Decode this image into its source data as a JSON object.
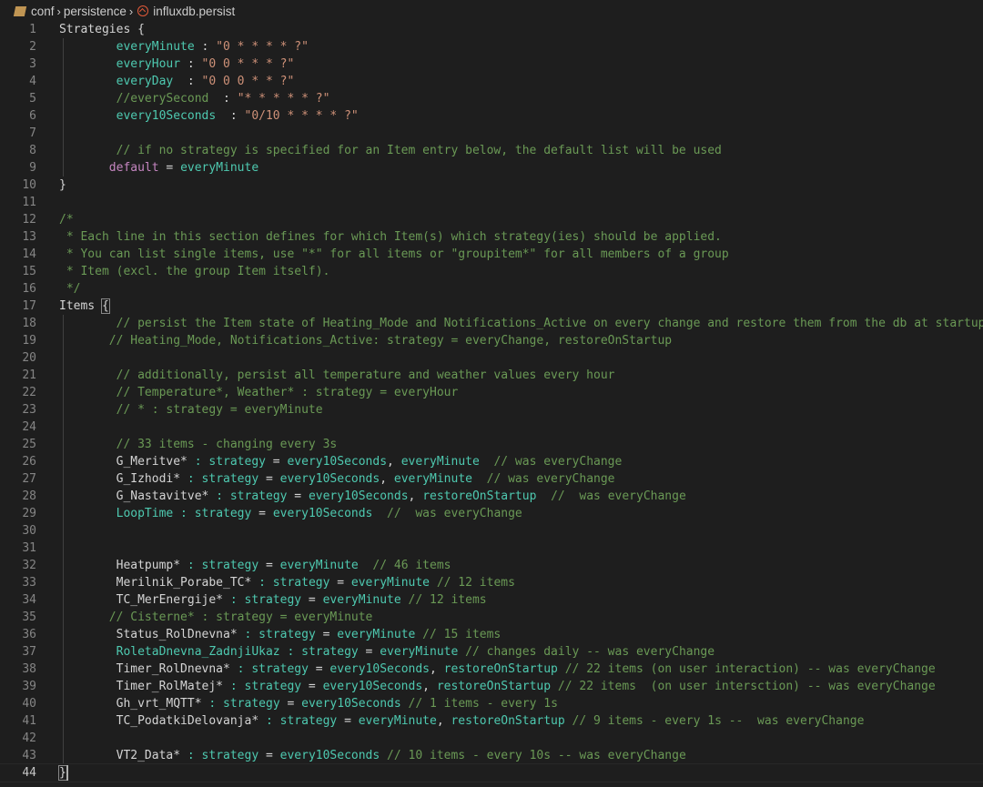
{
  "breadcrumb": {
    "items": [
      "conf",
      "persistence",
      "influxdb.persist"
    ]
  },
  "colors": {
    "background": "#1e1e1e",
    "type": "#4ec9b0",
    "string": "#ce9178",
    "comment": "#6a9955",
    "keyword": "#c586c0",
    "text": "#d4d4d4"
  },
  "editor": {
    "current_line": 44,
    "lines": [
      [
        [
          "Strategies {",
          "k"
        ]
      ],
      [
        [
          "        everyMinute",
          "t"
        ],
        [
          " : ",
          "k"
        ],
        [
          "\"0 * * * * ?\"",
          "s"
        ]
      ],
      [
        [
          "        everyHour",
          "t"
        ],
        [
          " : ",
          "k"
        ],
        [
          "\"0 0 * * * ?\"",
          "s"
        ]
      ],
      [
        [
          "        everyDay",
          "t"
        ],
        [
          "  : ",
          "k"
        ],
        [
          "\"0 0 0 * * ?\"",
          "s"
        ]
      ],
      [
        [
          "        //everySecond",
          "c"
        ],
        [
          "  : ",
          "k"
        ],
        [
          "\"* * * * * ?\"",
          "s"
        ]
      ],
      [
        [
          "        every10Seconds",
          "t"
        ],
        [
          "  : ",
          "k"
        ],
        [
          "\"0/10 * * * * ?\"",
          "s"
        ]
      ],
      [],
      [
        [
          "        // if no strategy is specified for an Item entry below, the default list will be used",
          "c"
        ]
      ],
      [
        [
          "       default",
          "p"
        ],
        [
          " = ",
          "k"
        ],
        [
          "everyMinute",
          "t"
        ]
      ],
      [
        [
          "}",
          "k"
        ]
      ],
      [],
      [
        [
          "/*",
          "c"
        ]
      ],
      [
        [
          " * Each line in this section defines for which Item(s) which strategy(ies) should be applied.",
          "c"
        ]
      ],
      [
        [
          " * You can list single items, use \"*\" for all items or \"groupitem*\" for all members of a group",
          "c"
        ]
      ],
      [
        [
          " * Item (excl. the group Item itself).",
          "c"
        ]
      ],
      [
        [
          " */",
          "c"
        ]
      ],
      [
        [
          "Items ",
          "k"
        ],
        [
          "{",
          "b"
        ]
      ],
      [
        [
          "        // persist the Item state of Heating_Mode and Notifications_Active on every change and restore them from the db at startup",
          "c"
        ]
      ],
      [
        [
          "       // Heating_Mode, Notifications_Active: strategy = everyChange, restoreOnStartup",
          "c"
        ]
      ],
      [],
      [
        [
          "        // additionally, persist all temperature and weather values every hour",
          "c"
        ]
      ],
      [
        [
          "        // Temperature*, Weather* : strategy = everyHour",
          "c"
        ]
      ],
      [
        [
          "        // * : strategy = everyMinute",
          "c"
        ]
      ],
      [],
      [
        [
          "        // 33 items - changing every 3s",
          "c"
        ]
      ],
      [
        [
          "        G_Meritve*",
          "k"
        ],
        [
          " : strategy",
          "t"
        ],
        [
          " = ",
          "k"
        ],
        [
          "every10Seconds",
          "t"
        ],
        [
          ", ",
          "k"
        ],
        [
          "everyMinute",
          "t"
        ],
        [
          "  // was everyChange",
          "c"
        ]
      ],
      [
        [
          "        G_Izhodi*",
          "k"
        ],
        [
          " : strategy",
          "t"
        ],
        [
          " = ",
          "k"
        ],
        [
          "every10Seconds",
          "t"
        ],
        [
          ", ",
          "k"
        ],
        [
          "everyMinute",
          "t"
        ],
        [
          "  // was everyChange",
          "c"
        ]
      ],
      [
        [
          "        G_Nastavitve*",
          "k"
        ],
        [
          " : strategy",
          "t"
        ],
        [
          " = ",
          "k"
        ],
        [
          "every10Seconds",
          "t"
        ],
        [
          ", ",
          "k"
        ],
        [
          "restoreOnStartup",
          "t"
        ],
        [
          "  //  was everyChange",
          "c"
        ]
      ],
      [
        [
          "        LoopTime",
          "t"
        ],
        [
          " : strategy",
          "t"
        ],
        [
          " = ",
          "k"
        ],
        [
          "every10Seconds",
          "t"
        ],
        [
          "  //  was everyChange",
          "c"
        ]
      ],
      [],
      [],
      [
        [
          "        Heatpump*",
          "k"
        ],
        [
          " : strategy",
          "t"
        ],
        [
          " = ",
          "k"
        ],
        [
          "everyMinute",
          "t"
        ],
        [
          "  // 46 items",
          "c"
        ]
      ],
      [
        [
          "        Merilnik_Porabe_TC*",
          "k"
        ],
        [
          " : strategy",
          "t"
        ],
        [
          " = ",
          "k"
        ],
        [
          "everyMinute",
          "t"
        ],
        [
          " // 12 items",
          "c"
        ]
      ],
      [
        [
          "        TC_MerEnergije*",
          "k"
        ],
        [
          " : strategy",
          "t"
        ],
        [
          " = ",
          "k"
        ],
        [
          "everyMinute",
          "t"
        ],
        [
          " // 12 items",
          "c"
        ]
      ],
      [
        [
          "       // Cisterne* : strategy = everyMinute",
          "c"
        ]
      ],
      [
        [
          "        Status_RolDnevna*",
          "k"
        ],
        [
          " : strategy",
          "t"
        ],
        [
          " = ",
          "k"
        ],
        [
          "everyMinute",
          "t"
        ],
        [
          " // 15 items",
          "c"
        ]
      ],
      [
        [
          "        RoletaDnevna_ZadnjiUkaz",
          "t"
        ],
        [
          " : strategy",
          "t"
        ],
        [
          " = ",
          "k"
        ],
        [
          "everyMinute",
          "t"
        ],
        [
          " // changes daily -- was everyChange",
          "c"
        ]
      ],
      [
        [
          "        Timer_RolDnevna*",
          "k"
        ],
        [
          " : strategy",
          "t"
        ],
        [
          " = ",
          "k"
        ],
        [
          "every10Seconds",
          "t"
        ],
        [
          ", ",
          "k"
        ],
        [
          "restoreOnStartup",
          "t"
        ],
        [
          " // 22 items (on user interaction) -- was everyChange",
          "c"
        ]
      ],
      [
        [
          "        Timer_RolMatej*",
          "k"
        ],
        [
          " : strategy",
          "t"
        ],
        [
          " = ",
          "k"
        ],
        [
          "every10Seconds",
          "t"
        ],
        [
          ", ",
          "k"
        ],
        [
          "restoreOnStartup",
          "t"
        ],
        [
          " // 22 items  (on user intersction) -- was everyChange",
          "c"
        ]
      ],
      [
        [
          "        Gh_vrt_MQTT*",
          "k"
        ],
        [
          " : strategy",
          "t"
        ],
        [
          " = ",
          "k"
        ],
        [
          "every10Seconds",
          "t"
        ],
        [
          " // 1 items - every 1s",
          "c"
        ]
      ],
      [
        [
          "        TC_PodatkiDelovanja*",
          "k"
        ],
        [
          " : strategy",
          "t"
        ],
        [
          " = ",
          "k"
        ],
        [
          "everyMinute",
          "t"
        ],
        [
          ", ",
          "k"
        ],
        [
          "restoreOnStartup",
          "t"
        ],
        [
          " // 9 items - every 1s --  was everyChange",
          "c"
        ]
      ],
      [],
      [
        [
          "        VT2_Data*",
          "k"
        ],
        [
          " : strategy",
          "t"
        ],
        [
          " = ",
          "k"
        ],
        [
          "every10Seconds",
          "t"
        ],
        [
          " // 10 items - every 10s -- was everyChange",
          "c"
        ]
      ],
      [
        [
          "}",
          "b"
        ]
      ]
    ]
  }
}
